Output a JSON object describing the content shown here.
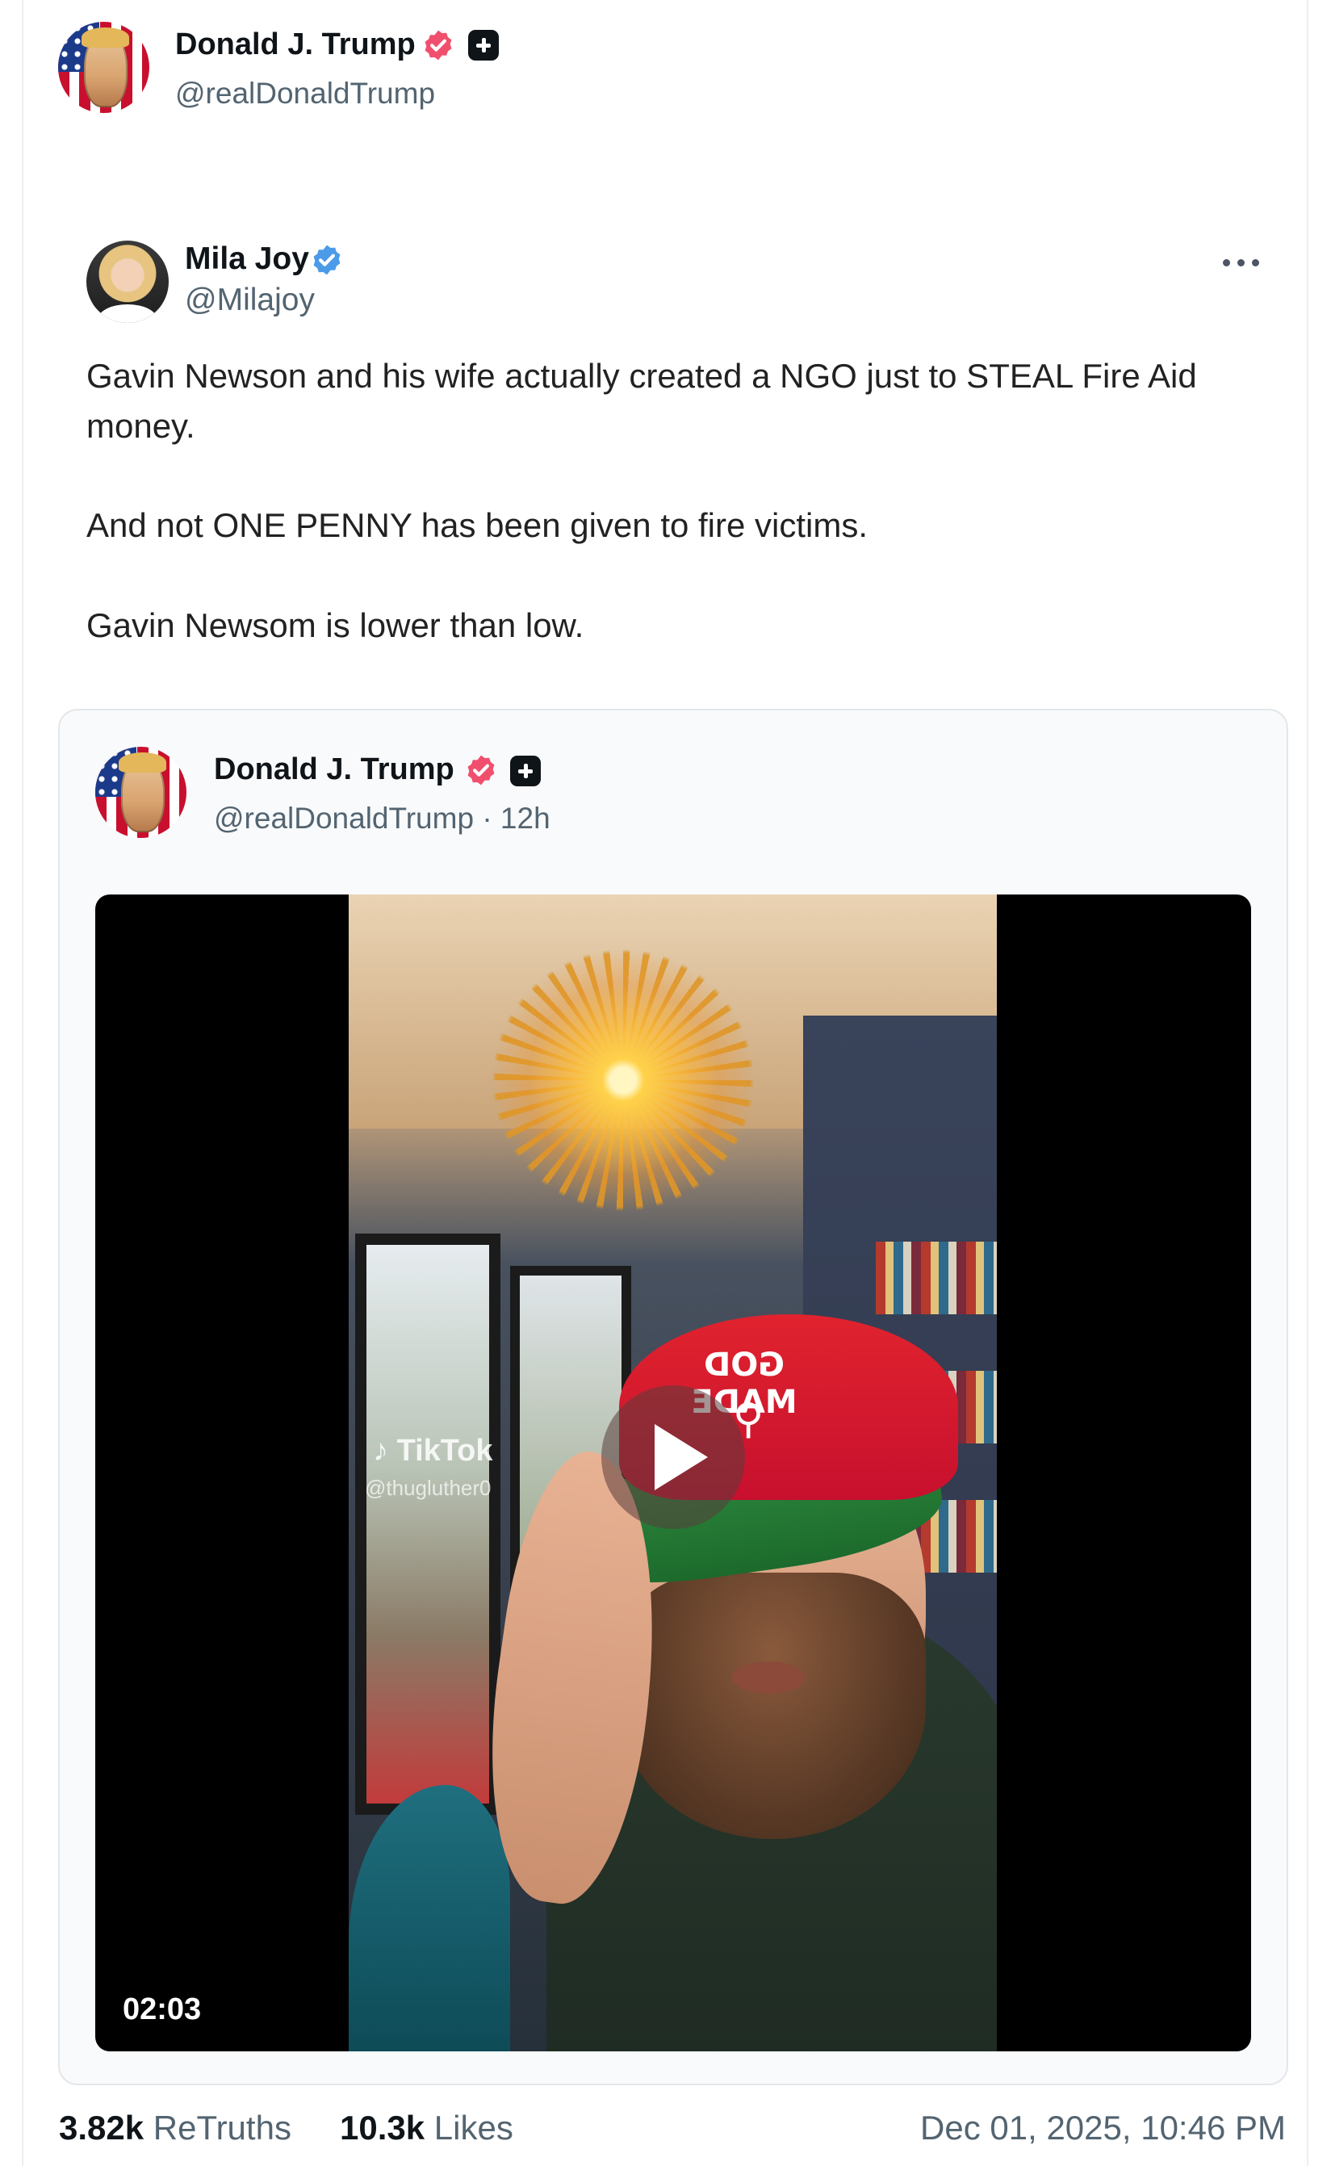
{
  "post": {
    "author": {
      "name": "Donald J. Trump",
      "handle": "@realDonaldTrump",
      "verified_color": "#f0506e"
    },
    "quoted_post": {
      "author": {
        "name": "Mila Joy",
        "handle": "@Milajoy",
        "verified_color": "#4c9be8"
      },
      "paragraphs": [
        "Gavin Newson and his wife actually created a NGO just to STEAL Fire Aid",
        "money.",
        "And not ONE PENNY has been given to fire victims.",
        "Gavin Newsom is lower than low."
      ],
      "embedded": {
        "author": {
          "name": "Donald J. Trump",
          "handle": "@realDonaldTrump",
          "time": "· 12h"
        },
        "video": {
          "duration": "02:03",
          "watermark": "TikTok",
          "watermark_handle": "@thugluther0",
          "cap_text": "GOD MADE"
        }
      }
    },
    "stats": {
      "retruths_count": "3.82k",
      "retruths_label": "ReTruths",
      "likes_count": "10.3k",
      "likes_label": "Likes"
    },
    "timestamp": "Dec 01, 2025, 10:46 PM"
  }
}
